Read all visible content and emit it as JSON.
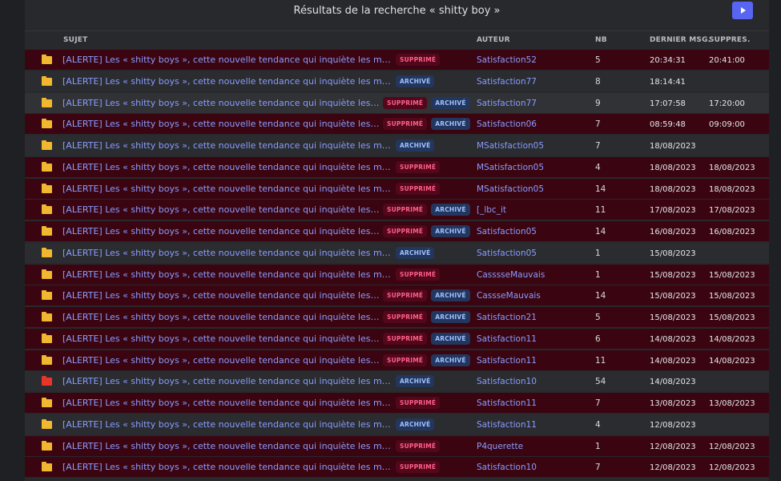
{
  "page": {
    "title": "Résultats de la recherche « shitty boy »",
    "next_button": "next-page"
  },
  "columns": {
    "subject": "SUJET",
    "author": "AUTEUR",
    "count": "NB",
    "last_msg": "DERNIER MSG.",
    "deleted_at": "SUPPRES."
  },
  "badges": {
    "deleted": "SUPPRIMÉ",
    "archived": "ARCHIVÉ"
  },
  "rows": [
    {
      "subject": "[ALERTE] Les « shitty boys », cette nouvelle tendance qui inquiète les médecins",
      "deleted": true,
      "archived": false,
      "author": "Satisfaction52",
      "nb": "5",
      "last": "20:34:31",
      "supp": "20:41:00",
      "icon": "folder",
      "selected": false
    },
    {
      "subject": "[ALERTE] Les « shitty boys », cette nouvelle tendance qui inquiète les médecins",
      "deleted": false,
      "archived": true,
      "author": "Satisfaction77",
      "nb": "8",
      "last": "18:14:41",
      "supp": "",
      "icon": "folder",
      "selected": false
    },
    {
      "subject": "[ALERTE] Les « shitty boys », cette nouvelle tendance qui inquiète les médecins",
      "deleted": true,
      "archived": true,
      "author": "Satisfaction77",
      "nb": "9",
      "last": "17:07:58",
      "supp": "17:20:00",
      "icon": "folder",
      "selected": true
    },
    {
      "subject": "[ALERTE] Les « shitty boys », cette nouvelle tendance qui inquiète les médecins",
      "deleted": true,
      "archived": true,
      "author": "Satisfaction06",
      "nb": "7",
      "last": "08:59:48",
      "supp": "09:09:00",
      "icon": "folder",
      "selected": false
    },
    {
      "subject": "[ALERTE] Les « shitty boys », cette nouvelle tendance qui inquiète les médecins",
      "deleted": false,
      "archived": true,
      "author": "MSatisfaction05",
      "nb": "7",
      "last": "18/08/2023",
      "supp": "",
      "icon": "folder",
      "selected": false
    },
    {
      "subject": "[ALERTE] Les « shitty boys », cette nouvelle tendance qui inquiète les médecins",
      "deleted": true,
      "archived": false,
      "author": "MSatisfaction05",
      "nb": "4",
      "last": "18/08/2023",
      "supp": "18/08/2023",
      "icon": "folder",
      "selected": false
    },
    {
      "subject": "[ALERTE] Les « shitty boys », cette nouvelle tendance qui inquiète les médecins",
      "deleted": true,
      "archived": false,
      "author": "MSatisfaction05",
      "nb": "14",
      "last": "18/08/2023",
      "supp": "18/08/2023",
      "icon": "folder",
      "selected": false
    },
    {
      "subject": "[ALERTE] Les « shitty boys », cette nouvelle tendance qui inquiète les médecins",
      "deleted": true,
      "archived": true,
      "author": "[_lbc_it",
      "nb": "11",
      "last": "17/08/2023",
      "supp": "17/08/2023",
      "icon": "folder",
      "selected": false
    },
    {
      "subject": "[ALERTE] Les « shitty boys », cette nouvelle tendance qui inquiète les médecins",
      "deleted": true,
      "archived": true,
      "author": "Satisfaction05",
      "nb": "14",
      "last": "16/08/2023",
      "supp": "16/08/2023",
      "icon": "folder",
      "selected": false
    },
    {
      "subject": "[ALERTE] Les « shitty boys », cette nouvelle tendance qui inquiète les médecins",
      "deleted": false,
      "archived": true,
      "author": "Satisfaction05",
      "nb": "1",
      "last": "15/08/2023",
      "supp": "",
      "icon": "folder",
      "selected": false
    },
    {
      "subject": "[ALERTE] Les « shitty boys », cette nouvelle tendance qui inquiète les médecins",
      "deleted": true,
      "archived": false,
      "author": "CasssseMauvais",
      "nb": "1",
      "last": "15/08/2023",
      "supp": "15/08/2023",
      "icon": "folder",
      "selected": false
    },
    {
      "subject": "[ALERTE] Les « shitty boys », cette nouvelle tendance qui inquiète les médecins",
      "deleted": true,
      "archived": true,
      "author": "CassseMauvais",
      "nb": "14",
      "last": "15/08/2023",
      "supp": "15/08/2023",
      "icon": "folder",
      "selected": false
    },
    {
      "subject": "[ALERTE] Les « shitty boys », cette nouvelle tendance qui inquiète les médecins",
      "deleted": true,
      "archived": true,
      "author": "Satisfaction21",
      "nb": "5",
      "last": "15/08/2023",
      "supp": "15/08/2023",
      "icon": "folder",
      "selected": false
    },
    {
      "subject": "[ALERTE] Les « shitty boys », cette nouvelle tendance qui inquiète les médecins",
      "deleted": true,
      "archived": true,
      "author": "Satisfaction11",
      "nb": "6",
      "last": "14/08/2023",
      "supp": "14/08/2023",
      "icon": "folder",
      "selected": false
    },
    {
      "subject": "[ALERTE] Les « shitty boys », cette nouvelle tendance qui inquiète les médecins",
      "deleted": true,
      "archived": true,
      "author": "Satisfaction11",
      "nb": "11",
      "last": "14/08/2023",
      "supp": "14/08/2023",
      "icon": "folder",
      "selected": false
    },
    {
      "subject": "[ALERTE] Les « shitty boys », cette nouvelle tendance qui inquiète les médecins",
      "deleted": false,
      "archived": true,
      "author": "Satisfaction10",
      "nb": "54",
      "last": "14/08/2023",
      "supp": "",
      "icon": "folder-hot",
      "selected": false
    },
    {
      "subject": "[ALERTE] Les « shitty boys », cette nouvelle tendance qui inquiète les médecins",
      "deleted": true,
      "archived": false,
      "author": "Satisfaction11",
      "nb": "7",
      "last": "13/08/2023",
      "supp": "13/08/2023",
      "icon": "folder",
      "selected": false
    },
    {
      "subject": "[ALERTE] Les « shitty boys », cette nouvelle tendance qui inquiète les médecins",
      "deleted": false,
      "archived": true,
      "author": "Satisfaction11",
      "nb": "4",
      "last": "12/08/2023",
      "supp": "",
      "icon": "folder",
      "selected": false
    },
    {
      "subject": "[ALERTE] Les « shitty boys », cette nouvelle tendance qui inquiète les médecins",
      "deleted": true,
      "archived": false,
      "author": "P4querette",
      "nb": "1",
      "last": "12/08/2023",
      "supp": "12/08/2023",
      "icon": "folder",
      "selected": false
    },
    {
      "subject": "[ALERTE] Les « shitty boys », cette nouvelle tendance qui inquiète les médecins",
      "deleted": true,
      "archived": false,
      "author": "Satisfaction10",
      "nb": "7",
      "last": "12/08/2023",
      "supp": "12/08/2023",
      "icon": "folder",
      "selected": false
    }
  ]
}
